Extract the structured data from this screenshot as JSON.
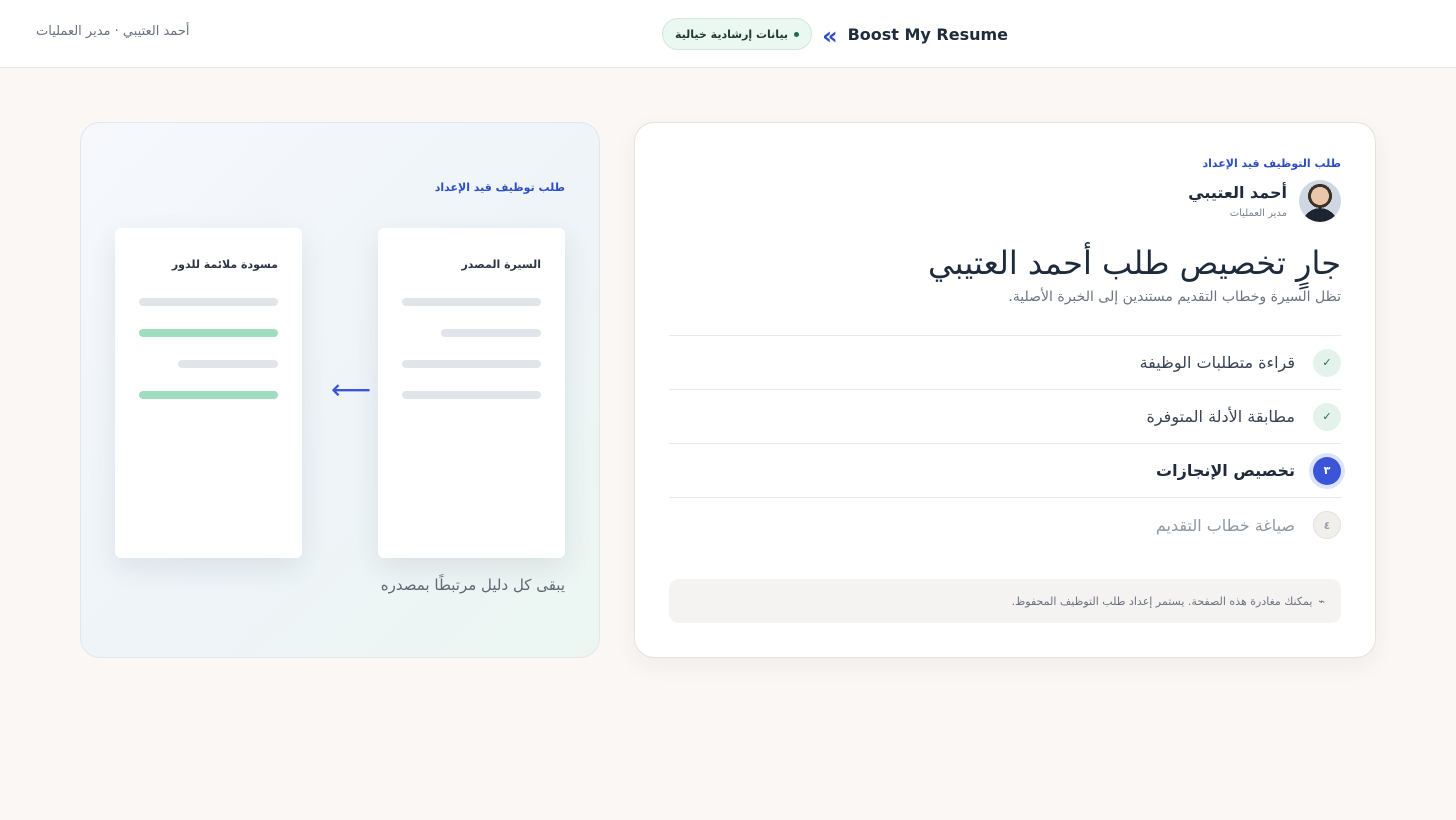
{
  "header": {
    "user_info": "أحمد العتيبي · مدير العمليات",
    "badge": "بيانات إرشادية خيالية",
    "logo_icon": "«",
    "brand_name": "Boost My Resume"
  },
  "status_card": {
    "eyebrow": "طلب التوظيف قيد الإعداد",
    "profile": {
      "name": "أحمد العتيبي",
      "role": "مدير العمليات"
    },
    "title": "جارٍ تخصيص طلب أحمد العتيبي",
    "subtitle": "تظل السيرة وخطاب التقديم مستندين إلى الخبرة الأصلية.",
    "steps": [
      {
        "mark": "✓",
        "label": "قراءة متطلبات الوظيفة",
        "state": "done"
      },
      {
        "mark": "✓",
        "label": "مطابقة الأدلة المتوفرة",
        "state": "done"
      },
      {
        "mark": "٣",
        "label": "تخصيص الإنجازات",
        "state": "active"
      },
      {
        "mark": "٤",
        "label": "صياغة خطاب التقديم",
        "state": "pending"
      }
    ],
    "note_icon": "⌁",
    "note": "يمكنك مغادرة هذه الصفحة. يستمر إعداد طلب التوظيف المحفوظ."
  },
  "illustration": {
    "eyebrow": "طلب توظيف قيد الإعداد",
    "source_doc_title": "السيرة المصدر",
    "draft_doc_title": "مسودة ملائمة للدور",
    "arrow": "⟵",
    "caption": "يبقى كل دليل مرتبطًا بمصدره"
  },
  "colors": {
    "accent": "#3b55d9",
    "done": "#1f6b4a",
    "match_bar": "#9fdcc0"
  }
}
